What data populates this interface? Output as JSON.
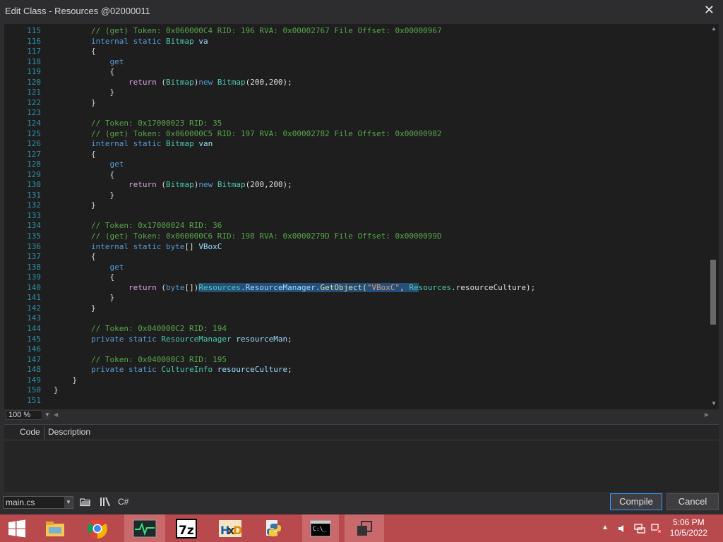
{
  "window": {
    "title": "Edit Class - Resources @02000011",
    "close_glyph": "✕"
  },
  "editor": {
    "lines": [
      {
        "n": "115",
        "parts": [
          [
            "c-cmt",
            "        // (get) Token: 0x060000C4 RID: 196 RVA: 0x00002767 File Offset: 0x00000967"
          ]
        ]
      },
      {
        "n": "116",
        "parts": [
          [
            "c-kw",
            "        internal static "
          ],
          [
            "c-type",
            "Bitmap"
          ],
          [
            "",
            ""
          ],
          [
            "c-id",
            " va"
          ]
        ]
      },
      {
        "n": "117",
        "parts": [
          [
            "",
            "        {"
          ]
        ]
      },
      {
        "n": "118",
        "parts": [
          [
            "c-kw",
            "            get"
          ]
        ]
      },
      {
        "n": "119",
        "parts": [
          [
            "",
            "            {"
          ]
        ]
      },
      {
        "n": "120",
        "parts": [
          [
            "c-ret",
            "                return"
          ],
          [
            "",
            " ("
          ],
          [
            "c-type",
            "Bitmap"
          ],
          [
            "",
            ")"
          ],
          [
            "c-kw",
            "new "
          ],
          [
            "c-type",
            "Bitmap"
          ],
          [
            "",
            "(200,200);"
          ]
        ]
      },
      {
        "n": "121",
        "parts": [
          [
            "",
            "            }"
          ]
        ]
      },
      {
        "n": "122",
        "parts": [
          [
            "",
            "        }"
          ]
        ]
      },
      {
        "n": "123",
        "parts": [
          [
            "",
            ""
          ]
        ]
      },
      {
        "n": "124",
        "parts": [
          [
            "c-cmt",
            "        // Token: 0x17000023 RID: 35"
          ]
        ]
      },
      {
        "n": "125",
        "parts": [
          [
            "c-cmt",
            "        // (get) Token: 0x060000C5 RID: 197 RVA: 0x00002782 File Offset: 0x00000982"
          ]
        ]
      },
      {
        "n": "126",
        "parts": [
          [
            "c-kw",
            "        internal static "
          ],
          [
            "c-type",
            "Bitmap"
          ],
          [
            "c-id",
            " van"
          ]
        ]
      },
      {
        "n": "127",
        "parts": [
          [
            "",
            "        {"
          ]
        ]
      },
      {
        "n": "128",
        "parts": [
          [
            "c-kw",
            "            get"
          ]
        ]
      },
      {
        "n": "129",
        "parts": [
          [
            "",
            "            {"
          ]
        ]
      },
      {
        "n": "130",
        "parts": [
          [
            "c-ret",
            "                return"
          ],
          [
            "",
            " ("
          ],
          [
            "c-type",
            "Bitmap"
          ],
          [
            "",
            ")"
          ],
          [
            "c-kw",
            "new "
          ],
          [
            "c-type",
            "Bitmap"
          ],
          [
            "",
            "(200,200);"
          ]
        ]
      },
      {
        "n": "131",
        "parts": [
          [
            "",
            "            }"
          ]
        ]
      },
      {
        "n": "132",
        "parts": [
          [
            "",
            "        }"
          ]
        ]
      },
      {
        "n": "133",
        "parts": [
          [
            "",
            ""
          ]
        ]
      },
      {
        "n": "134",
        "parts": [
          [
            "c-cmt",
            "        // Token: 0x17000024 RID: 36"
          ]
        ]
      },
      {
        "n": "135",
        "parts": [
          [
            "c-cmt",
            "        // (get) Token: 0x060000C6 RID: 198 RVA: 0x0000279D File Offset: 0x0000099D"
          ]
        ]
      },
      {
        "n": "136",
        "parts": [
          [
            "c-kw",
            "        internal static byte"
          ],
          [
            "",
            "[] "
          ],
          [
            "c-id",
            "VBoxC"
          ]
        ]
      },
      {
        "n": "137",
        "parts": [
          [
            "",
            "        {"
          ]
        ]
      },
      {
        "n": "138",
        "parts": [
          [
            "c-kw",
            "            get"
          ]
        ]
      },
      {
        "n": "139",
        "parts": [
          [
            "",
            "            {"
          ]
        ]
      },
      {
        "n": "140",
        "parts": [
          [
            "c-ret",
            "                return"
          ],
          [
            "",
            " ("
          ],
          [
            "c-kw",
            "byte"
          ],
          [
            "",
            "[])"
          ],
          [
            "c-type sel",
            "Resources"
          ],
          [
            "sel",
            "."
          ],
          [
            "c-id sel",
            "ResourceManager"
          ],
          [
            "sel",
            "."
          ],
          [
            "c-meth sel",
            "GetObject"
          ],
          [
            "sel",
            "("
          ],
          [
            "c-str sel",
            "\"VBoxC\""
          ],
          [
            "sel",
            ", "
          ],
          [
            "c-type sel",
            "Re"
          ],
          [
            "c-type",
            "sources"
          ],
          [
            "",
            ".resourceCulture);"
          ]
        ]
      },
      {
        "n": "141",
        "parts": [
          [
            "",
            "            }"
          ]
        ]
      },
      {
        "n": "142",
        "parts": [
          [
            "",
            "        }"
          ]
        ]
      },
      {
        "n": "143",
        "parts": [
          [
            "",
            ""
          ]
        ]
      },
      {
        "n": "144",
        "parts": [
          [
            "c-cmt",
            "        // Token: 0x040000C2 RID: 194"
          ]
        ]
      },
      {
        "n": "145",
        "parts": [
          [
            "c-kw",
            "        private static "
          ],
          [
            "c-type",
            "ResourceManager"
          ],
          [
            "c-id",
            " resourceMan"
          ],
          [
            "",
            ";"
          ]
        ]
      },
      {
        "n": "146",
        "parts": [
          [
            "",
            ""
          ]
        ]
      },
      {
        "n": "147",
        "parts": [
          [
            "c-cmt",
            "        // Token: 0x040000C3 RID: 195"
          ]
        ]
      },
      {
        "n": "148",
        "parts": [
          [
            "c-kw",
            "        private static "
          ],
          [
            "c-type",
            "CultureInfo"
          ],
          [
            "c-id",
            " resourceCulture"
          ],
          [
            "",
            ";"
          ]
        ]
      },
      {
        "n": "149",
        "parts": [
          [
            "",
            "    }"
          ]
        ]
      },
      {
        "n": "150",
        "parts": [
          [
            "",
            "}"
          ]
        ]
      },
      {
        "n": "151",
        "parts": [
          [
            "",
            ""
          ]
        ]
      }
    ]
  },
  "zoom": {
    "value": "100 %"
  },
  "errors": {
    "col_code": "Code",
    "col_description": "Description"
  },
  "bottom": {
    "file": "main.cs",
    "tool_csharp": "C#",
    "compile_label": "Compile",
    "cancel_label": "Cancel"
  },
  "taskbar": {
    "items": [
      "windows-start",
      "file-explorer",
      "chrome",
      "activity-monitor",
      "7zip",
      "hxd",
      "python",
      "command-prompt",
      "task-view"
    ],
    "clock_time": "5:06 PM",
    "clock_date": "10/5/2022",
    "colors": {
      "bar": "#b84a4e",
      "active": "#c9696c"
    }
  }
}
